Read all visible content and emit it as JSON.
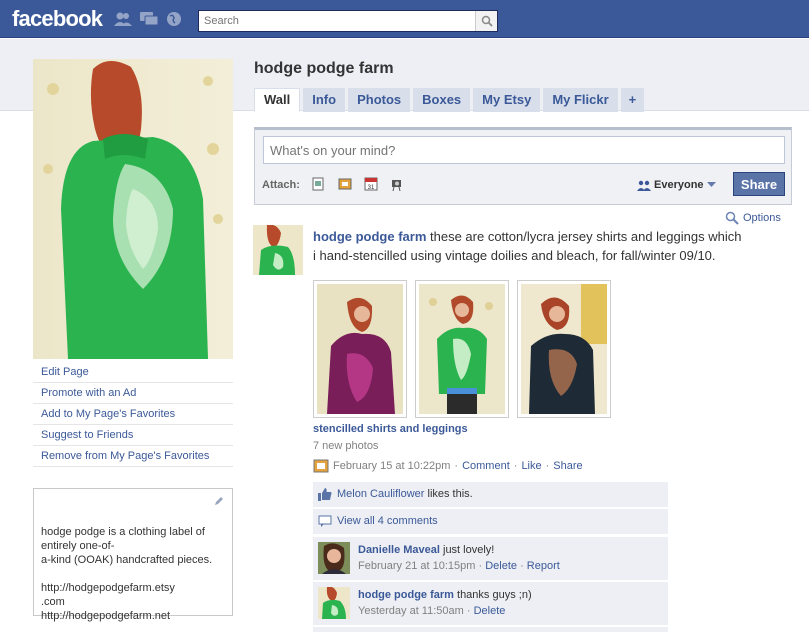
{
  "app": {
    "logo": "facebook"
  },
  "search": {
    "placeholder": "Search"
  },
  "page": {
    "title": "hodge podge farm"
  },
  "tabs": [
    {
      "label": "Wall"
    },
    {
      "label": "Info"
    },
    {
      "label": "Photos"
    },
    {
      "label": "Boxes"
    },
    {
      "label": "My Etsy"
    },
    {
      "label": "My Flickr"
    },
    {
      "label": "+"
    }
  ],
  "left_links": [
    {
      "label": "Edit Page"
    },
    {
      "label": "Promote with an Ad"
    },
    {
      "label": "Add to My Page's Favorites"
    },
    {
      "label": "Suggest to Friends"
    },
    {
      "label": "Remove from My Page's Favorites"
    }
  ],
  "info_box": {
    "text": "hodge podge is a clothing label of entirely one-of-\na-kind (OOAK) handcrafted pieces.\n\nhttp://hodgepodgefarm.etsy\n.com\nhttp://hodgepodgefarm.net"
  },
  "composer": {
    "placeholder": "What's on your mind?",
    "attach_label": "Attach:",
    "privacy": "Everyone",
    "share_label": "Share"
  },
  "options_label": "Options",
  "story": {
    "actor": "hodge podge farm",
    "text": " these are cotton/lycra jersey shirts and leggings which i hand-stencilled using vintage doilies and bleach, for fall/winter 09/10.",
    "album_title": "stencilled shirts and leggings",
    "album_count": "7 new photos",
    "timestamp": "February 15 at 10:22pm",
    "actions": {
      "comment": "Comment",
      "like": "Like",
      "share": "Share"
    },
    "sep": "·",
    "likes": {
      "name": "Melon Cauliflower",
      "suffix": " likes this."
    },
    "view_all": "View all 4 comments",
    "comments": [
      {
        "author": "Danielle Maveal",
        "text": " just lovely!",
        "time": "February 21 at 10:15pm",
        "a1": "Delete",
        "a2": "Report"
      },
      {
        "author": "hodge podge farm",
        "text": " thanks guys ;n)",
        "time": "Yesterday at 11:50am",
        "a1": "Delete"
      }
    ]
  },
  "colors": {
    "brand": "#3b5998",
    "band": "#edeff4",
    "shirt_green": "#2bb34f"
  }
}
